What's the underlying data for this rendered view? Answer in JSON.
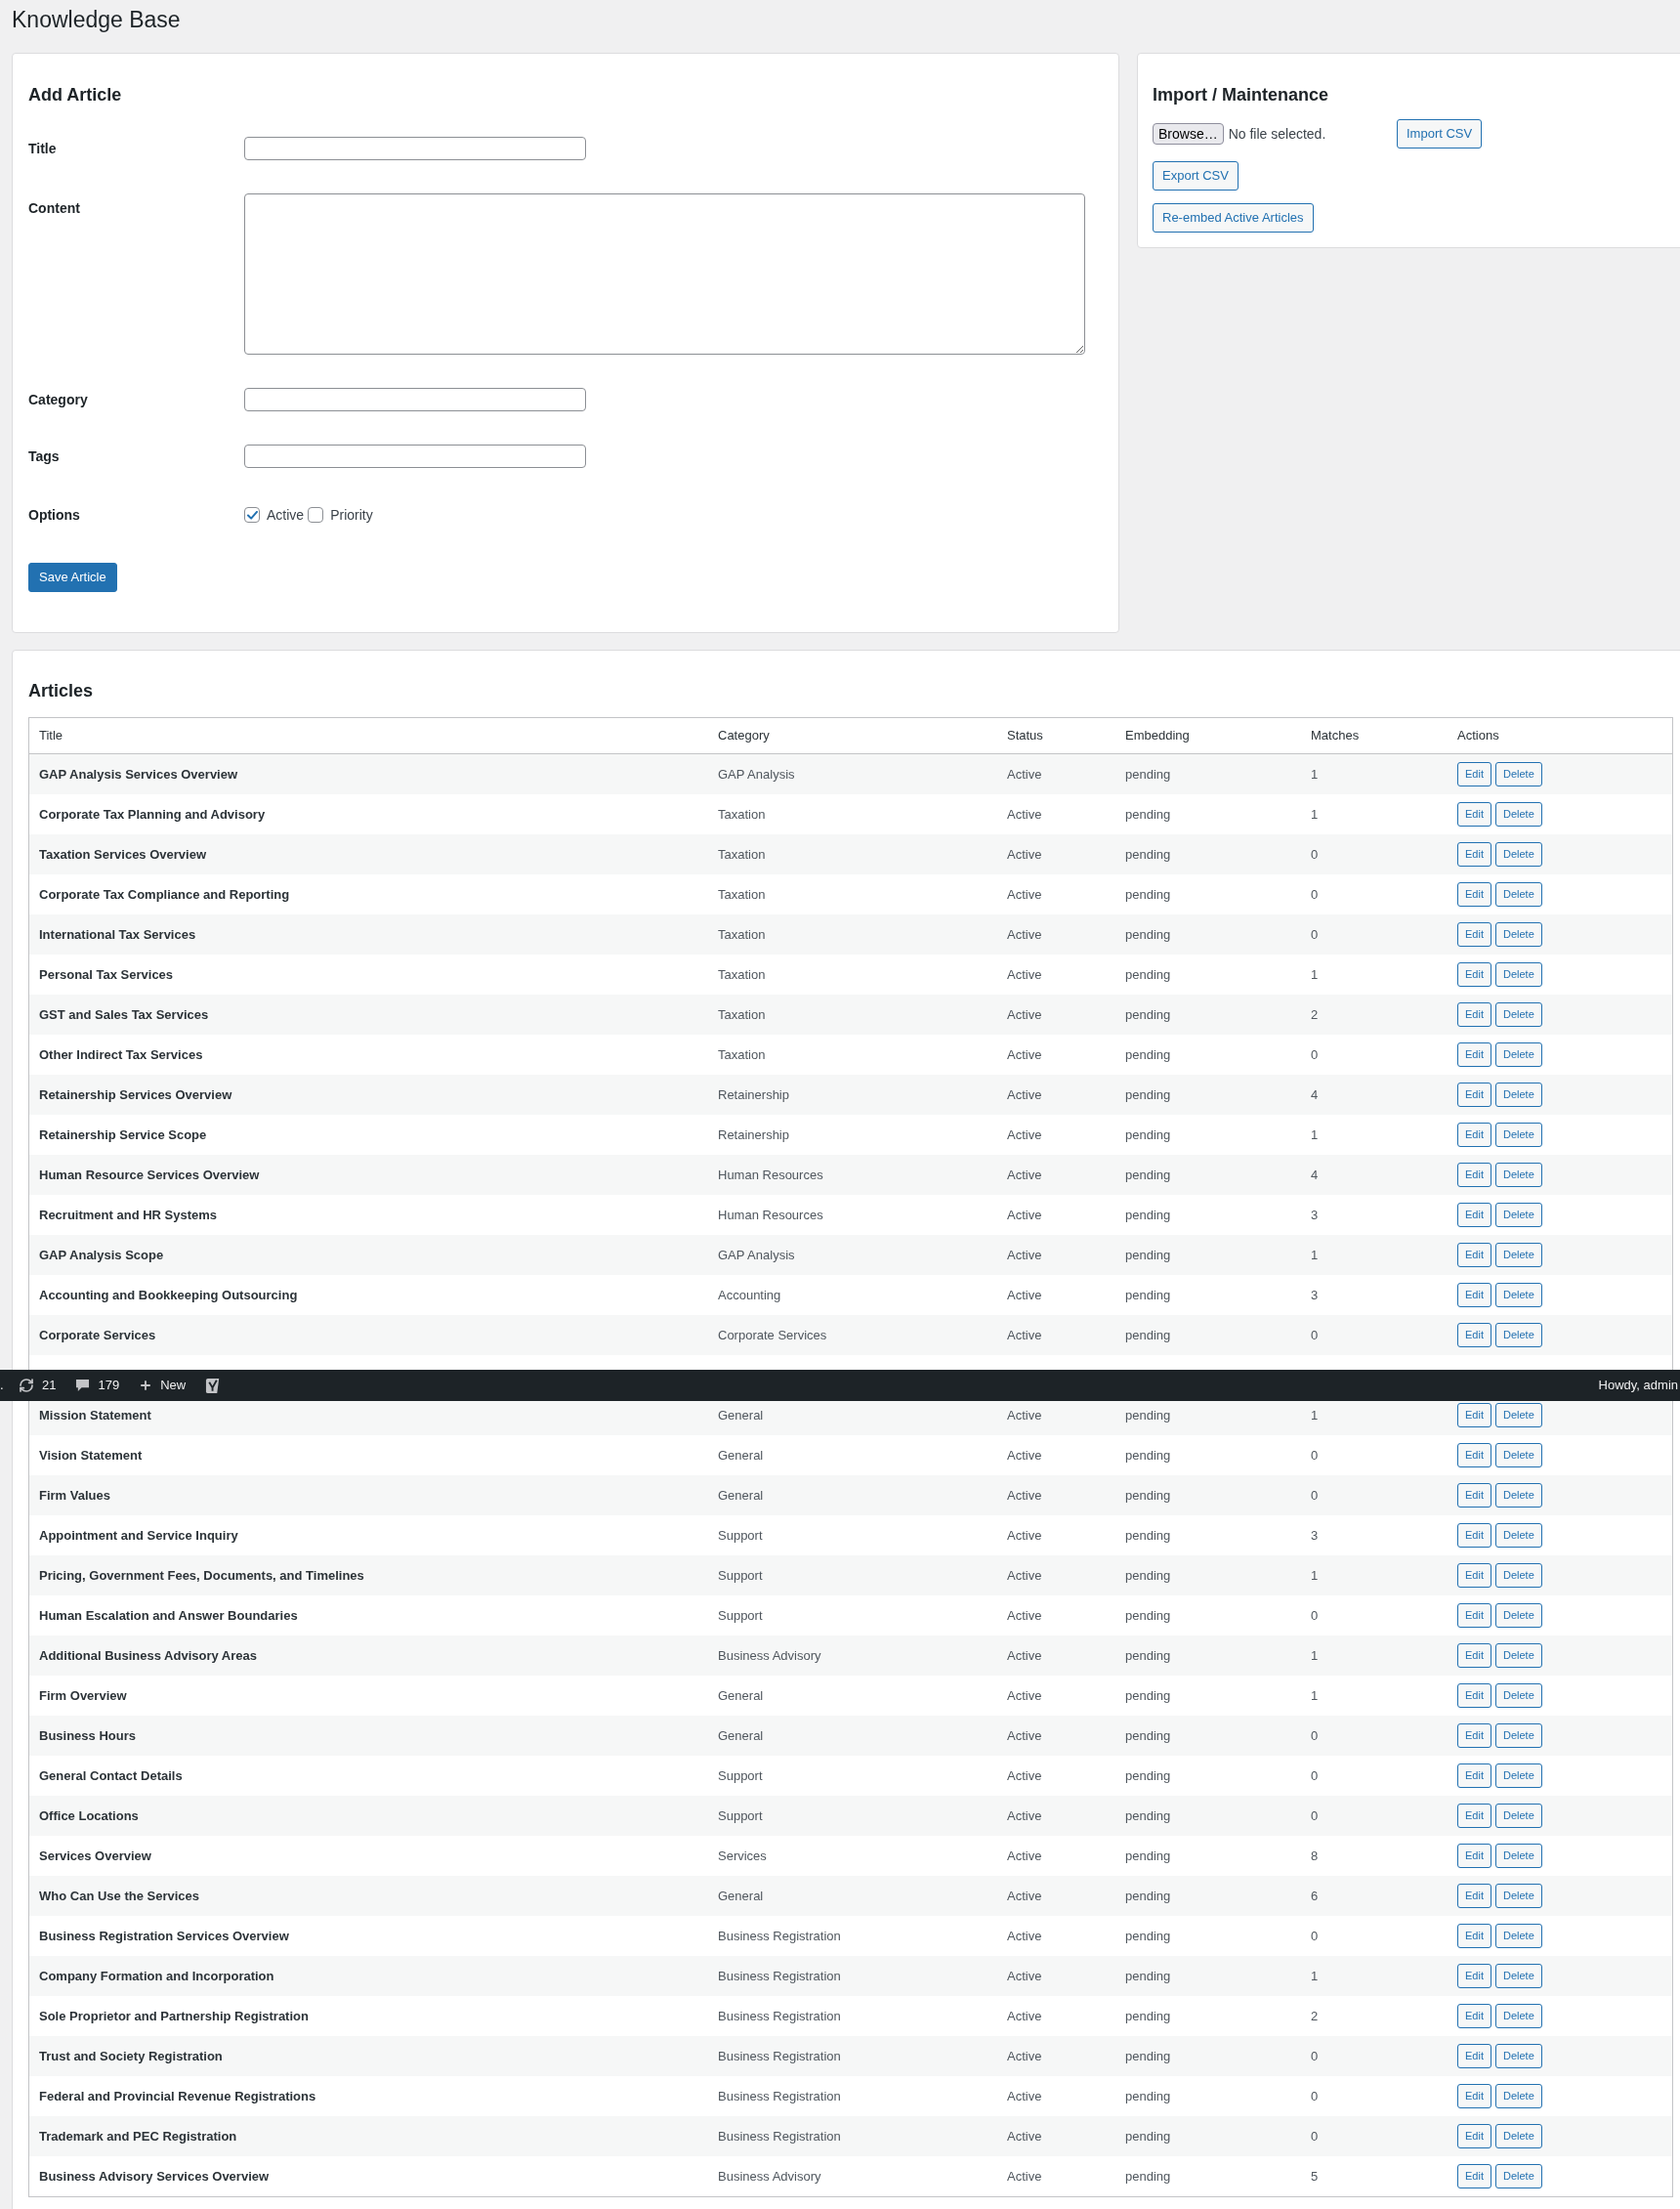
{
  "page_title": "Knowledge Base",
  "add_article": {
    "title": "Add Article",
    "fields": [
      {
        "label": "Title",
        "kind": "text"
      },
      {
        "label": "Content",
        "kind": "textarea"
      },
      {
        "label": "Category",
        "kind": "text"
      },
      {
        "label": "Tags",
        "kind": "text"
      }
    ],
    "options": {
      "label": "Options",
      "items": [
        {
          "label": "Active",
          "checked": true
        },
        {
          "label": "Priority",
          "checked": false
        }
      ]
    },
    "submit": "Save Article"
  },
  "import_panel": {
    "title": "Import / Maintenance",
    "file_input": {
      "button": "Browse…",
      "status": "No file selected."
    },
    "import_button": "Import CSV",
    "buttons": [
      "Export CSV",
      "Re-embed Active Articles"
    ]
  },
  "articles": {
    "title": "Articles",
    "columns": [
      "Title",
      "Category",
      "Status",
      "Embedding",
      "Matches",
      "Actions"
    ],
    "rows": [
      {
        "kind": "article",
        "title": "GAP Analysis Services Overview",
        "category": "GAP Analysis",
        "status": "Active",
        "embedding": "pending",
        "matches": "1",
        "actions": [
          "Edit",
          "Delete"
        ]
      },
      {
        "kind": "article",
        "title": "Corporate Tax Planning and Advisory",
        "category": "Taxation",
        "status": "Active",
        "embedding": "pending",
        "matches": "1",
        "actions": [
          "Edit",
          "Delete"
        ]
      },
      {
        "kind": "article",
        "title": "Taxation Services Overview",
        "category": "Taxation",
        "status": "Active",
        "embedding": "pending",
        "matches": "0",
        "actions": [
          "Edit",
          "Delete"
        ]
      },
      {
        "kind": "article",
        "title": "Corporate Tax Compliance and Reporting",
        "category": "Taxation",
        "status": "Active",
        "embedding": "pending",
        "matches": "0",
        "actions": [
          "Edit",
          "Delete"
        ]
      },
      {
        "kind": "article",
        "title": "International Tax Services",
        "category": "Taxation",
        "status": "Active",
        "embedding": "pending",
        "matches": "0",
        "actions": [
          "Edit",
          "Delete"
        ]
      },
      {
        "kind": "article",
        "title": "Personal Tax Services",
        "category": "Taxation",
        "status": "Active",
        "embedding": "pending",
        "matches": "1",
        "actions": [
          "Edit",
          "Delete"
        ]
      },
      {
        "kind": "article",
        "title": "GST and Sales Tax Services",
        "category": "Taxation",
        "status": "Active",
        "embedding": "pending",
        "matches": "2",
        "actions": [
          "Edit",
          "Delete"
        ]
      },
      {
        "kind": "article",
        "title": "Other Indirect Tax Services",
        "category": "Taxation",
        "status": "Active",
        "embedding": "pending",
        "matches": "0",
        "actions": [
          "Edit",
          "Delete"
        ]
      },
      {
        "kind": "article",
        "title": "Retainership Services Overview",
        "category": "Retainership",
        "status": "Active",
        "embedding": "pending",
        "matches": "4",
        "actions": [
          "Edit",
          "Delete"
        ]
      },
      {
        "kind": "article",
        "title": "Retainership Service Scope",
        "category": "Retainership",
        "status": "Active",
        "embedding": "pending",
        "matches": "1",
        "actions": [
          "Edit",
          "Delete"
        ]
      },
      {
        "kind": "article",
        "title": "Human Resource Services Overview",
        "category": "Human Resources",
        "status": "Active",
        "embedding": "pending",
        "matches": "4",
        "actions": [
          "Edit",
          "Delete"
        ]
      },
      {
        "kind": "article",
        "title": "Recruitment and HR Systems",
        "category": "Human Resources",
        "status": "Active",
        "embedding": "pending",
        "matches": "3",
        "actions": [
          "Edit",
          "Delete"
        ]
      },
      {
        "kind": "article",
        "title": "GAP Analysis Scope",
        "category": "GAP Analysis",
        "status": "Active",
        "embedding": "pending",
        "matches": "1",
        "actions": [
          "Edit",
          "Delete"
        ]
      },
      {
        "kind": "article",
        "title": "Accounting and Bookkeeping Outsourcing",
        "category": "Accounting",
        "status": "Active",
        "embedding": "pending",
        "matches": "3",
        "actions": [
          "Edit",
          "Delete"
        ]
      },
      {
        "kind": "article",
        "title": "Corporate Services",
        "category": "Corporate Services",
        "status": "Active",
        "embedding": "pending",
        "matches": "0",
        "actions": [
          "Edit",
          "Delete"
        ]
      },
      {
        "kind": "covered"
      },
      {
        "kind": "article",
        "title": "Mission Statement",
        "category": "General",
        "status": "Active",
        "embedding": "pending",
        "matches": "1",
        "actions": [
          "Edit",
          "Delete"
        ]
      },
      {
        "kind": "article",
        "title": "Vision Statement",
        "category": "General",
        "status": "Active",
        "embedding": "pending",
        "matches": "0",
        "actions": [
          "Edit",
          "Delete"
        ]
      },
      {
        "kind": "article",
        "title": "Firm Values",
        "category": "General",
        "status": "Active",
        "embedding": "pending",
        "matches": "0",
        "actions": [
          "Edit",
          "Delete"
        ]
      },
      {
        "kind": "article",
        "title": "Appointment and Service Inquiry",
        "category": "Support",
        "status": "Active",
        "embedding": "pending",
        "matches": "3",
        "actions": [
          "Edit",
          "Delete"
        ]
      },
      {
        "kind": "article",
        "title": "Pricing, Government Fees, Documents, and Timelines",
        "category": "Support",
        "status": "Active",
        "embedding": "pending",
        "matches": "1",
        "actions": [
          "Edit",
          "Delete"
        ]
      },
      {
        "kind": "article",
        "title": "Human Escalation and Answer Boundaries",
        "category": "Support",
        "status": "Active",
        "embedding": "pending",
        "matches": "0",
        "actions": [
          "Edit",
          "Delete"
        ]
      },
      {
        "kind": "article",
        "title": "Additional Business Advisory Areas",
        "category": "Business Advisory",
        "status": "Active",
        "embedding": "pending",
        "matches": "1",
        "actions": [
          "Edit",
          "Delete"
        ]
      },
      {
        "kind": "article",
        "title": "Firm Overview",
        "category": "General",
        "status": "Active",
        "embedding": "pending",
        "matches": "1",
        "actions": [
          "Edit",
          "Delete"
        ]
      },
      {
        "kind": "article",
        "title": "Business Hours",
        "category": "General",
        "status": "Active",
        "embedding": "pending",
        "matches": "0",
        "actions": [
          "Edit",
          "Delete"
        ]
      },
      {
        "kind": "article",
        "title": "General Contact Details",
        "category": "Support",
        "status": "Active",
        "embedding": "pending",
        "matches": "0",
        "actions": [
          "Edit",
          "Delete"
        ]
      },
      {
        "kind": "article",
        "title": "Office Locations",
        "category": "Support",
        "status": "Active",
        "embedding": "pending",
        "matches": "0",
        "actions": [
          "Edit",
          "Delete"
        ]
      },
      {
        "kind": "article",
        "title": "Services Overview",
        "category": "Services",
        "status": "Active",
        "embedding": "pending",
        "matches": "8",
        "actions": [
          "Edit",
          "Delete"
        ]
      },
      {
        "kind": "article",
        "title": "Who Can Use the Services",
        "category": "General",
        "status": "Active",
        "embedding": "pending",
        "matches": "6",
        "actions": [
          "Edit",
          "Delete"
        ]
      },
      {
        "kind": "article",
        "title": "Business Registration Services Overview",
        "category": "Business Registration",
        "status": "Active",
        "embedding": "pending",
        "matches": "0",
        "actions": [
          "Edit",
          "Delete"
        ]
      },
      {
        "kind": "article",
        "title": "Company Formation and Incorporation",
        "category": "Business Registration",
        "status": "Active",
        "embedding": "pending",
        "matches": "1",
        "actions": [
          "Edit",
          "Delete"
        ]
      },
      {
        "kind": "article",
        "title": "Sole Proprietor and Partnership Registration",
        "category": "Business Registration",
        "status": "Active",
        "embedding": "pending",
        "matches": "2",
        "actions": [
          "Edit",
          "Delete"
        ]
      },
      {
        "kind": "article",
        "title": "Trust and Society Registration",
        "category": "Business Registration",
        "status": "Active",
        "embedding": "pending",
        "matches": "0",
        "actions": [
          "Edit",
          "Delete"
        ]
      },
      {
        "kind": "article",
        "title": "Federal and Provincial Revenue Registrations",
        "category": "Business Registration",
        "status": "Active",
        "embedding": "pending",
        "matches": "0",
        "actions": [
          "Edit",
          "Delete"
        ]
      },
      {
        "kind": "article",
        "title": "Trademark and PEC Registration",
        "category": "Business Registration",
        "status": "Active",
        "embedding": "pending",
        "matches": "0",
        "actions": [
          "Edit",
          "Delete"
        ]
      },
      {
        "kind": "article",
        "title": "Business Advisory Services Overview",
        "category": "Business Advisory",
        "status": "Active",
        "embedding": "pending",
        "matches": "5",
        "actions": [
          "Edit",
          "Delete"
        ]
      }
    ]
  },
  "admin_bar": {
    "site_fragment": ".",
    "items": [
      {
        "kind": "updates",
        "text": "21"
      },
      {
        "kind": "comments",
        "text": "179"
      },
      {
        "kind": "new",
        "text": "New"
      },
      {
        "kind": "seo"
      }
    ],
    "greeting": "Howdy, admin"
  }
}
